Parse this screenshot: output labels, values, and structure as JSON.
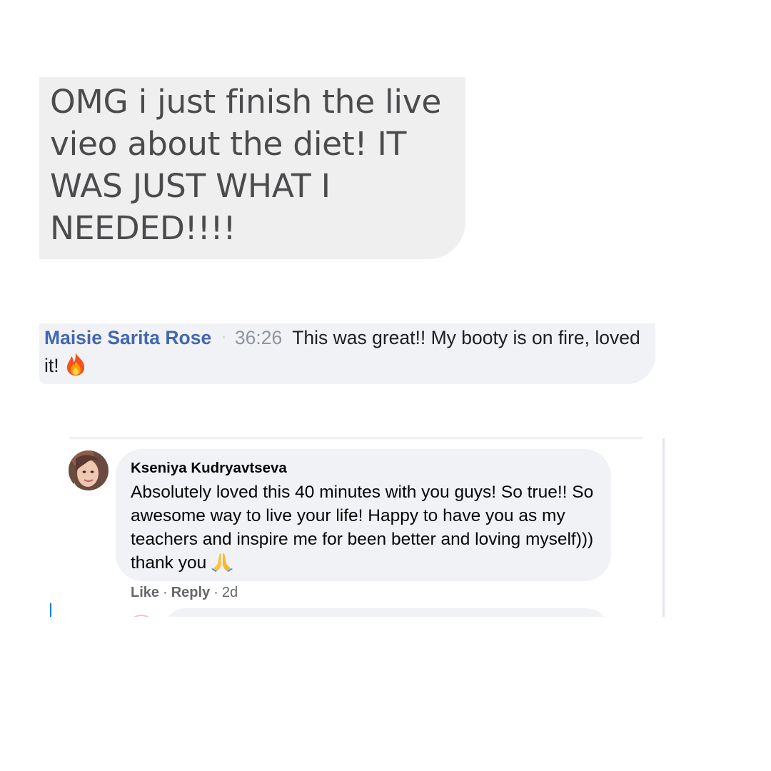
{
  "message_panel": {
    "text": "OMG i just finish the live vieo about the diet! IT WAS JUST WHAT I NEEDED!!!!"
  },
  "live_comment": {
    "author": "Maisie Sarita Rose",
    "separator": "·",
    "timestamp": "36:26",
    "text": "This was great!! My booty is on fire, loved it!",
    "emoji": "fire-emoji"
  },
  "comment_thread": {
    "author": "Kseniya Kudryavtseva",
    "text": "Absolutely loved this 40 minutes with you guys! So true!! So awesome way to live your life! Happy to have you as my teachers and inspire me for been better and loving myself))) thank you",
    "emoji": "folded-hands-emoji",
    "actions": {
      "like": "Like",
      "reply": "Reply",
      "separator": "·",
      "age": "2d"
    }
  },
  "colors": {
    "author_link": "#4267b2",
    "bubble_gray": "#f0f2f5",
    "message_gray": "#efefef",
    "meta_gray": "#65676b"
  }
}
